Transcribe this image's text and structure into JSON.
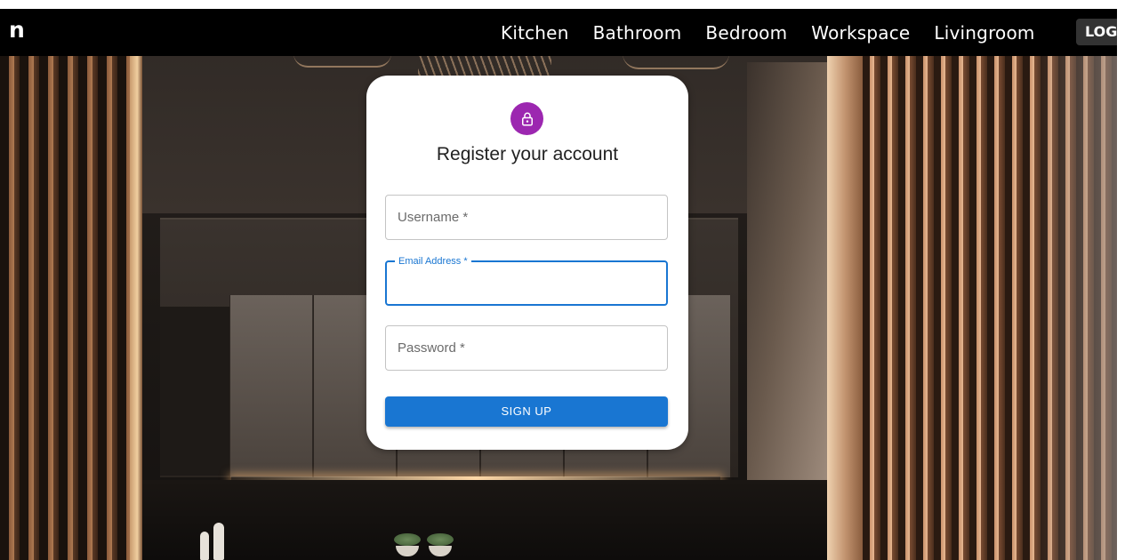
{
  "navbar": {
    "brand": "n",
    "links": [
      "Kitchen",
      "Bathroom",
      "Bedroom",
      "Workspace",
      "Livingroom"
    ],
    "login_label": "LOG"
  },
  "register": {
    "title": "Register your account",
    "username_label": "Username *",
    "email_label": "Email Address *",
    "password_label": "Password *",
    "signup_label": "SIGN UP",
    "icon": "lock-icon"
  },
  "colors": {
    "navbar": "#000000",
    "avatar": "#9c27b0",
    "primary": "#1976d2"
  }
}
